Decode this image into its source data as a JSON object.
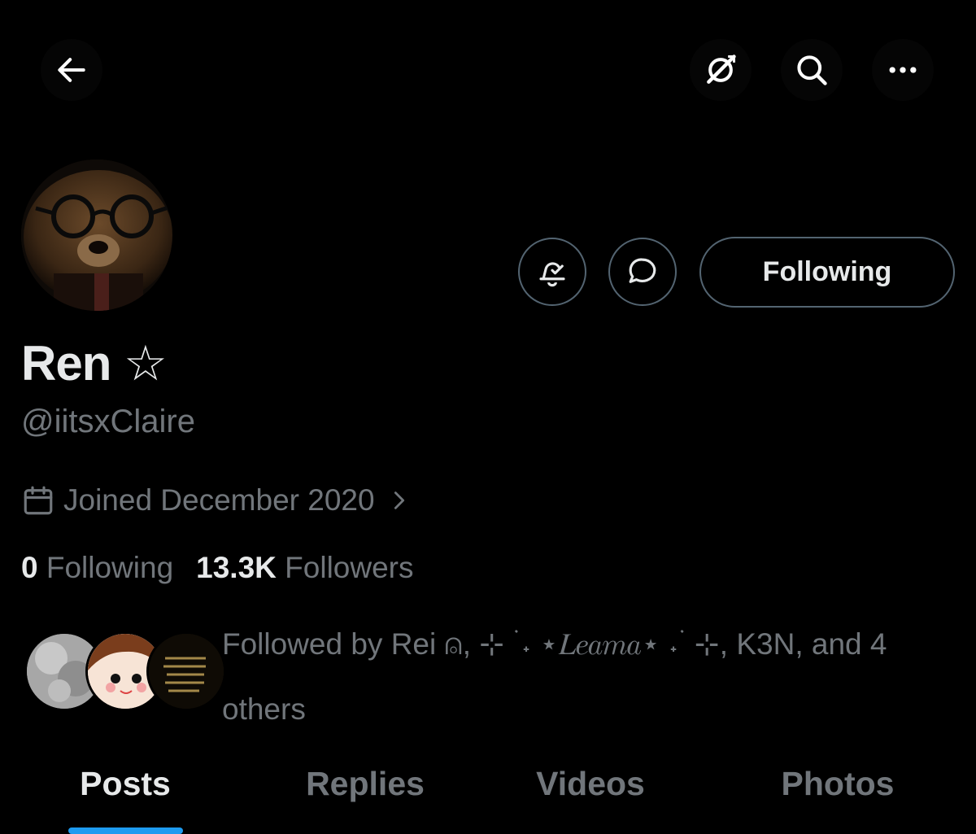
{
  "profile": {
    "display_name": "Ren ☆",
    "handle": "@iitsxClaire",
    "joined": "Joined December 2020",
    "following_count": "0",
    "following_label": "Following",
    "followers_count": "13.3K",
    "followers_label": "Followers",
    "followed_by": "Followed by Rei ⍝, ⊹ ࣪ ˖ ⋆𝐿𝑒𝑎𝑚𝑎⋆ ˖ ࣪ ⊹, K3N, and 4 others"
  },
  "actions": {
    "follow_label": "Following"
  },
  "header": {
    "icons": [
      "back-arrow-icon",
      "grok-icon",
      "search-icon",
      "more-icon"
    ]
  },
  "tabs": [
    {
      "label": "Posts",
      "active": true
    },
    {
      "label": "Replies",
      "active": false
    },
    {
      "label": "Videos",
      "active": false
    },
    {
      "label": "Photos",
      "active": false
    }
  ],
  "colors": {
    "background": "#000000",
    "text_primary": "#e7e9ea",
    "text_secondary": "#71767b",
    "border": "#536471",
    "accent": "#1d9bf0"
  }
}
